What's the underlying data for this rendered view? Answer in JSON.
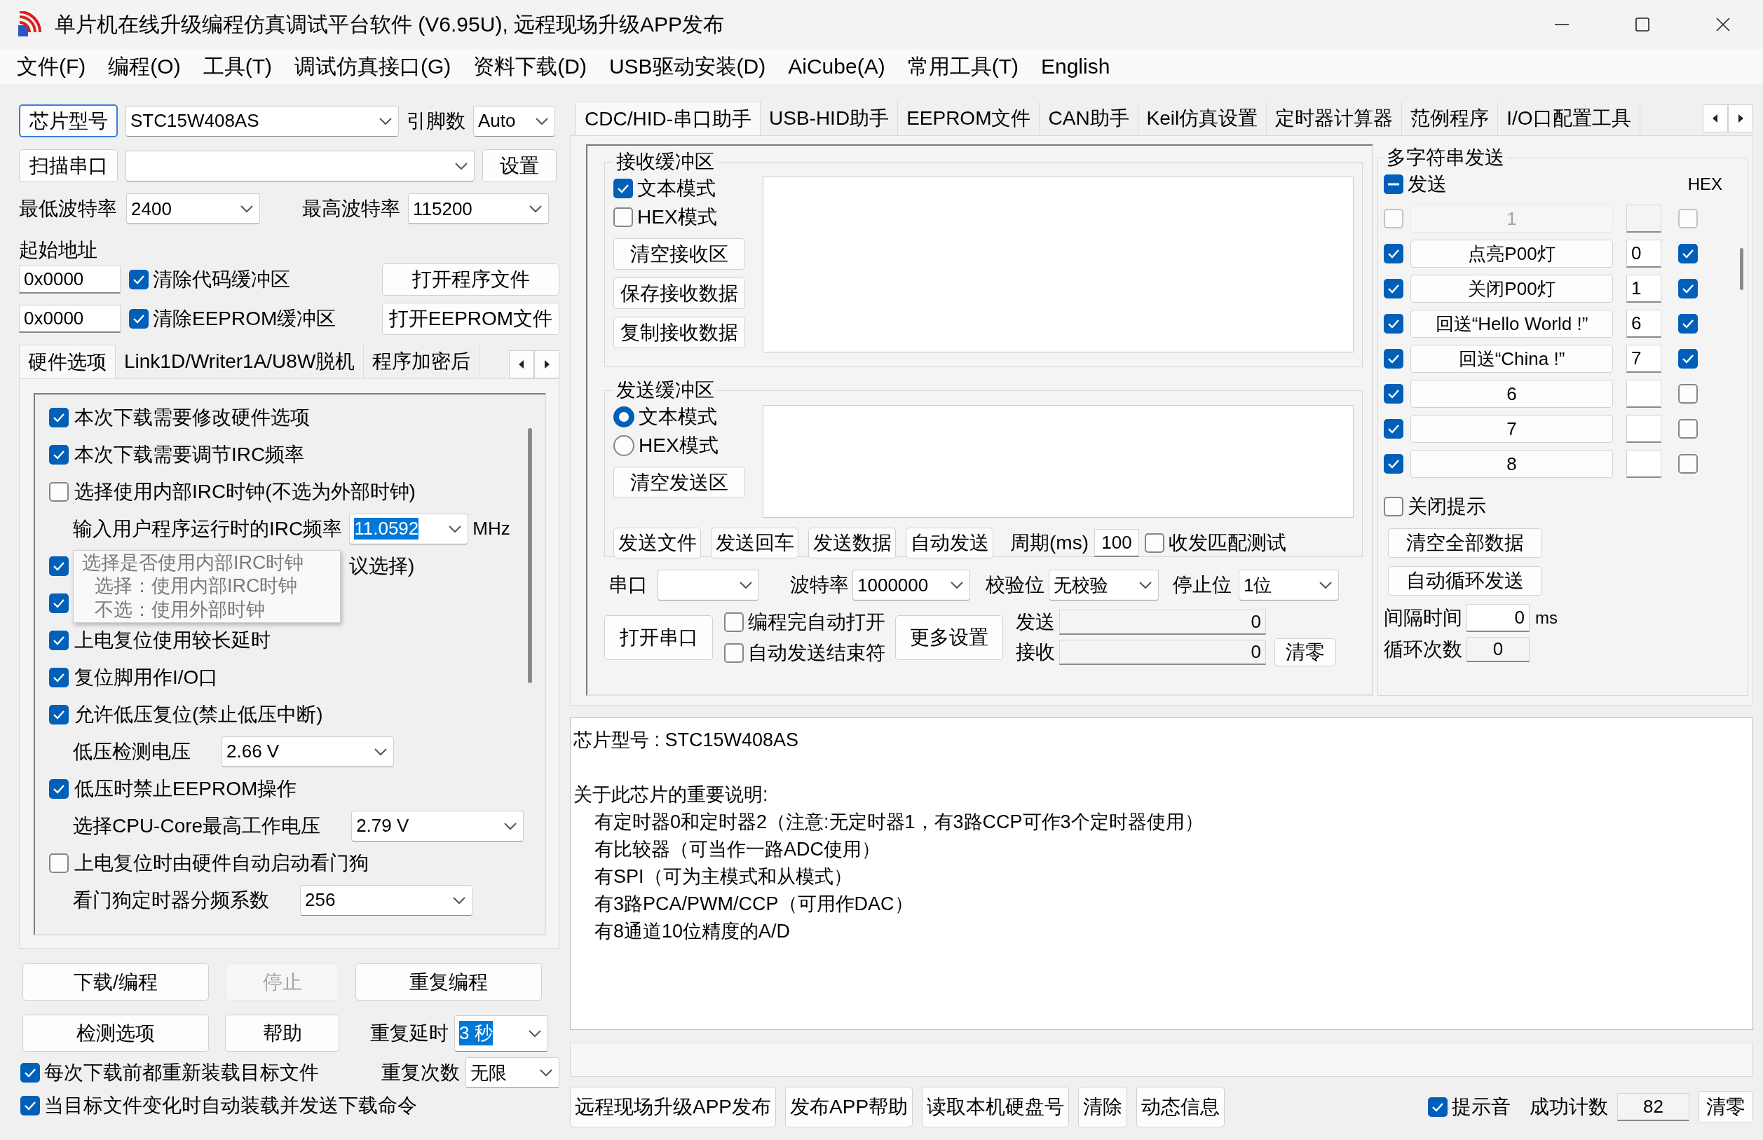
{
  "window": {
    "title": "单片机在线升级编程仿真调试平台软件 (V6.95U), 远程现场升级APP发布"
  },
  "menu": [
    "文件(F)",
    "编程(O)",
    "工具(T)",
    "调试仿真接口(G)",
    "资料下载(D)",
    "USB驱动安装(D)",
    "AiCube(A)",
    "常用工具(T)",
    "English"
  ],
  "chip": {
    "button": "芯片型号",
    "focused": true,
    "value": "STC15W408AS",
    "pins_label": "引脚数",
    "pins": "Auto"
  },
  "port": {
    "button": "扫描串口",
    "settings": "设置"
  },
  "baud": {
    "min_label": "最低波特率",
    "min": "2400",
    "max_label": "最高波特率",
    "max": "115200"
  },
  "address": {
    "label": "起始地址",
    "rows": [
      {
        "value": "0x0000",
        "option": "清除代码缓冲区",
        "checked": true,
        "button": "打开程序文件"
      },
      {
        "value": "0x0000",
        "option": "清除EEPROM缓冲区",
        "checked": true,
        "button": "打开EEPROM文件"
      }
    ]
  },
  "left_tabs": [
    {
      "label": "硬件选项",
      "selected": true
    },
    {
      "label": "Link1D/Writer1A/U8W脱机",
      "selected": false
    },
    {
      "label": "程序加密后",
      "selected": false
    }
  ],
  "options": [
    {
      "kind": "check",
      "label": "本次下载需要修改硬件选项",
      "checked": true
    },
    {
      "kind": "check",
      "label": "本次下载需要调节IRC频率",
      "checked": true
    },
    {
      "kind": "check",
      "label": "选择使用内部IRC时钟(不选为外部时钟)",
      "checked": false
    },
    {
      "kind": "select",
      "label": "输入用户程序运行时的IRC频率",
      "value": "11.0592",
      "highlighted": true,
      "unit": "MHz"
    },
    {
      "kind": "covered_check",
      "label": "议选择)",
      "checked": true
    },
    {
      "kind": "check",
      "checked": true
    },
    {
      "kind": "check",
      "label": "上电复位使用较长延时",
      "checked": true
    },
    {
      "kind": "check",
      "label": "复位脚用作I/O口",
      "checked": true
    },
    {
      "kind": "check",
      "label": "允许低压复位(禁止低压中断)",
      "checked": true
    },
    {
      "kind": "select",
      "label": "低压检测电压",
      "value": "2.66 V",
      "highlighted": false
    },
    {
      "kind": "check",
      "label": "低压时禁止EEPROM操作",
      "checked": true
    },
    {
      "kind": "select",
      "label": "选择CPU-Core最高工作电压",
      "value": "2.79 V",
      "highlighted": false
    },
    {
      "kind": "check",
      "label": "上电复位时由硬件自动启动看门狗",
      "checked": false
    },
    {
      "kind": "select",
      "label": "看门狗定时器分频系数",
      "value": "256",
      "highlighted": false
    }
  ],
  "tooltip": [
    "选择是否使用内部IRC时钟",
    "选择：使用内部IRC时钟",
    "不选：使用外部时钟"
  ],
  "actions": [
    {
      "label": "下载/编程",
      "disabled": false
    },
    {
      "label": "停止",
      "disabled": true
    },
    {
      "label": "重复编程",
      "disabled": false
    },
    {
      "label": "检测选项",
      "disabled": false
    },
    {
      "label": "帮助",
      "disabled": false
    }
  ],
  "repeat": {
    "delay_label": "重复延时",
    "delay": "3 秒",
    "delay_highlighted": true,
    "count_label": "重复次数",
    "count": "无限"
  },
  "reload": [
    {
      "label": "每次下载前都重新装载目标文件",
      "checked": true
    },
    {
      "label": "当目标文件变化时自动装载并发送下载命令",
      "checked": true
    }
  ],
  "tabs": [
    {
      "label": "CDC/HID-串口助手",
      "selected": true
    },
    {
      "label": "USB-HID助手",
      "selected": false
    },
    {
      "label": "EEPROM文件",
      "selected": false
    },
    {
      "label": "CAN助手",
      "selected": false
    },
    {
      "label": "Keil仿真设置",
      "selected": false
    },
    {
      "label": "定时器计算器",
      "selected": false
    },
    {
      "label": "范例程序",
      "selected": false
    },
    {
      "label": "I/O口配置工具",
      "selected": false
    }
  ],
  "receive": {
    "title": "接收缓冲区",
    "modes": [
      {
        "label": "文本模式",
        "checked": true
      },
      {
        "label": "HEX模式",
        "checked": false
      }
    ],
    "buttons": [
      "清空接收区",
      "保存接收数据",
      "复制接收数据"
    ]
  },
  "send": {
    "title": "发送缓冲区",
    "modes": [
      {
        "label": "文本模式",
        "selected": true
      },
      {
        "label": "HEX模式",
        "selected": false
      }
    ],
    "buttons": [
      "清空发送区"
    ],
    "actions": [
      "发送文件",
      "发送回车",
      "发送数据",
      "自动发送"
    ],
    "period_label": "周期(ms)",
    "period": "100",
    "match": {
      "label": "收发匹配测试",
      "checked": false
    }
  },
  "serial": {
    "port_label": "串口",
    "baud_label": "波特率",
    "baud": "1000000",
    "parity_label": "校验位",
    "parity": "无校验",
    "stop_label": "停止位",
    "stop": "1位",
    "open": "打开串口",
    "auto_open": {
      "label": "编程完自动打开",
      "checked": false
    },
    "auto_end": {
      "label": "自动发送结束符",
      "checked": false
    },
    "more": "更多设置",
    "sent_label": "发送",
    "sent": "0",
    "received_label": "接收",
    "received": "0",
    "reset": "清零"
  },
  "multi": {
    "title": "多字符串发送",
    "header": {
      "label": "发送",
      "checked": true,
      "partial": true
    },
    "hex_label": "HEX",
    "rows": [
      {
        "checked": false,
        "label": "1",
        "hex": false,
        "disabled": true
      },
      {
        "checked": true,
        "label": "点亮P00灯",
        "value": "0",
        "hex": true,
        "disabled": false
      },
      {
        "checked": true,
        "label": "关闭P00灯",
        "value": "1",
        "hex": true,
        "disabled": false
      },
      {
        "checked": true,
        "label": "回送“Hello World !”",
        "value": "6",
        "hex": true,
        "disabled": false
      },
      {
        "checked": true,
        "label": "回送“China !”",
        "value": "7",
        "hex": true,
        "disabled": false
      },
      {
        "checked": true,
        "label": "6",
        "hex": false,
        "disabled": false
      },
      {
        "checked": true,
        "label": "7",
        "hex": false,
        "disabled": false
      },
      {
        "checked": true,
        "label": "8",
        "hex": false,
        "disabled": false
      }
    ],
    "hide_tips": {
      "label": "关闭提示",
      "checked": false
    },
    "buttons": [
      "清空全部数据",
      "自动循环发送"
    ],
    "interval_label": "间隔时间",
    "interval": "0",
    "interval_unit": "ms",
    "loops_label": "循环次数",
    "loops": "0"
  },
  "info": {
    "chip_line": "芯片型号 : STC15W408AS",
    "notes_title": "关于此芯片的重要说明:",
    "notes": [
      "有定时器0和定时器2（注意:无定时器1，有3路CCP可作3个定时器使用）",
      "有比较器（可当作一路ADC使用）",
      "有SPI（可为主模式和从模式）",
      "有3路PCA/PWM/CCP（可用作DAC）",
      "有8通道10位精度的A/D"
    ]
  },
  "bottom": {
    "buttons": [
      "远程现场升级APP发布",
      "发布APP帮助",
      "读取本机硬盘号",
      "清除",
      "动态信息"
    ],
    "beep": {
      "label": "提示音",
      "checked": true
    },
    "count_label": "成功计数",
    "count": "82",
    "reset": "清零"
  }
}
